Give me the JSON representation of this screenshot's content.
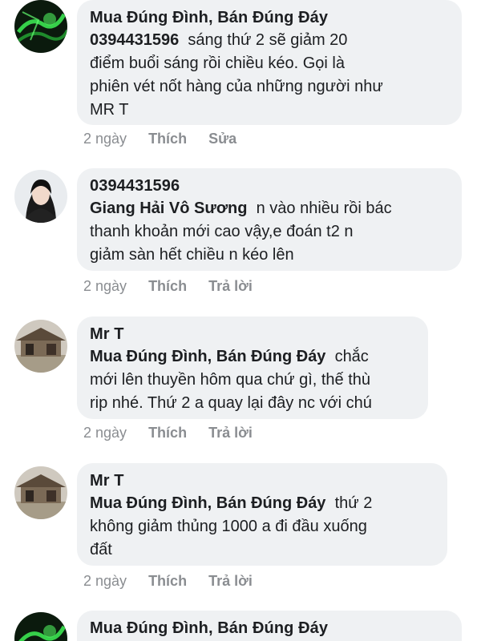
{
  "comments": [
    {
      "author": "Mua Đúng Đình, Bán Đúng Đáy",
      "mention": "0394431596",
      "text_lines": [
        "sáng thứ 2 sẽ giảm 20",
        "điểm buổi sáng rồi chiều kéo. Gọi là",
        "phiên vét nốt hàng của những người như",
        "MR T"
      ],
      "time": "2 ngày",
      "like": "Thích",
      "action": "Sửa",
      "avatar": "green-abstract-avatar"
    },
    {
      "author": "0394431596",
      "mention": "Giang Hải Vô Sương",
      "text_lines": [
        "n vào nhiều rồi bác",
        "thanh khoản mới cao vậy,e đoán t2 n",
        "giảm sàn hết chiều n kéo lên"
      ],
      "time": "2 ngày",
      "like": "Thích",
      "action": "Trả lời",
      "avatar": "woman-portrait-avatar"
    },
    {
      "author": "Mr T",
      "mention": "Mua Đúng Đình, Bán Đúng Đáy",
      "text_lines": [
        "chắc",
        "mới lên thuyền hôm qua chứ gì, thế thù",
        "rip nhé. Thứ 2 a quay lại đây nc với chú"
      ],
      "time": "2 ngày",
      "like": "Thích",
      "action": "Trả lời",
      "avatar": "old-house-avatar"
    },
    {
      "author": "Mr T",
      "mention": "Mua Đúng Đình, Bán Đúng Đáy",
      "text_lines": [
        "thứ 2",
        "không giảm thủng 1000 a đi đầu xuống",
        "đất"
      ],
      "time": "2 ngày",
      "like": "Thích",
      "action": "Trả lời",
      "avatar": "old-house-avatar"
    },
    {
      "author": "Mua Đúng Đình, Bán Đúng Đáy",
      "avatar": "green-abstract-avatar"
    }
  ]
}
